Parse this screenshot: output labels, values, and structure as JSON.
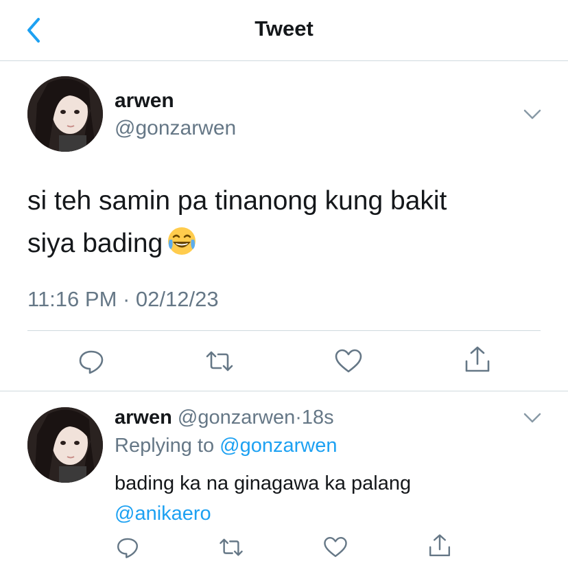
{
  "header": {
    "title": "Tweet",
    "back_icon": "chevron-left-icon",
    "accent_color": "#1da1f2"
  },
  "tweet": {
    "author_name": "arwen",
    "author_handle": "@gonzarwen",
    "text_line1": "si teh samin pa tinanong kung bakit",
    "text_line2": "siya bading",
    "emoji": "face-with-tears-of-joy",
    "timestamp": "11:16 PM · 02/12/23",
    "actions": [
      "reply-icon",
      "retweet-icon",
      "like-icon",
      "share-icon"
    ]
  },
  "reply": {
    "author_name": "arwen",
    "author_handle": "@gonzarwen",
    "separator": "·",
    "age": "18s",
    "replying_prefix": "Replying to",
    "replying_to": "@gonzarwen",
    "text_line1": "bading ka na ginagawa ka palang",
    "text_mention": "@anikaero",
    "actions": [
      "reply-icon",
      "retweet-icon",
      "like-icon",
      "share-icon"
    ]
  }
}
